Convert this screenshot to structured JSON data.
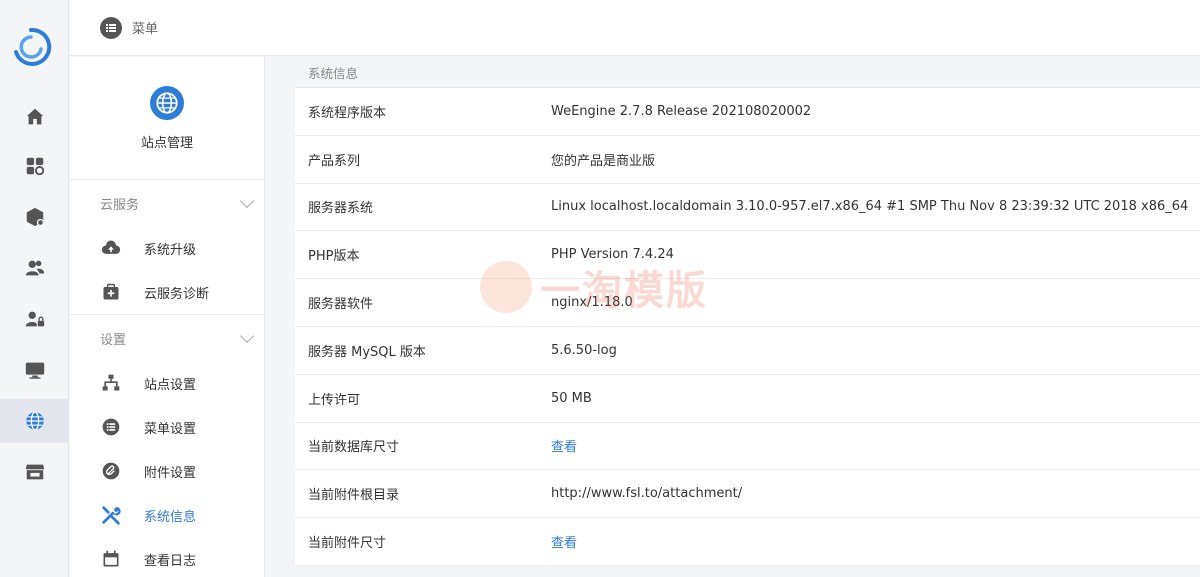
{
  "header": {
    "title": "菜单"
  },
  "rail": {
    "items": [
      {
        "icon": "home-icon"
      },
      {
        "icon": "apps-icon"
      },
      {
        "icon": "module-icon"
      },
      {
        "icon": "users-icon"
      },
      {
        "icon": "user-lock-icon"
      },
      {
        "icon": "monitor-icon"
      },
      {
        "icon": "globe-icon"
      },
      {
        "icon": "store-icon"
      }
    ]
  },
  "sidebar": {
    "site_label": "站点管理",
    "groups": [
      {
        "label": "云服务",
        "items": [
          {
            "label": "系统升级",
            "icon": "cloud-upload-icon"
          },
          {
            "label": "云服务诊断",
            "icon": "medkit-icon"
          }
        ]
      },
      {
        "label": "设置",
        "items": [
          {
            "label": "站点设置",
            "icon": "sitemap-icon"
          },
          {
            "label": "菜单设置",
            "icon": "list-icon"
          },
          {
            "label": "附件设置",
            "icon": "paperclip-icon"
          },
          {
            "label": "系统信息",
            "icon": "tools-icon"
          },
          {
            "label": "查看日志",
            "icon": "calendar-icon"
          }
        ]
      }
    ]
  },
  "system_info": {
    "heading": "系统信息",
    "rows": [
      {
        "key": "系统程序版本",
        "value": "WeEngine 2.7.8 Release 202108020002"
      },
      {
        "key": "产品系列",
        "value": "您的产品是商业版"
      },
      {
        "key": "服务器系统",
        "value": "Linux localhost.localdomain 3.10.0-957.el7.x86_64 #1 SMP Thu Nov 8 23:39:32 UTC 2018 x86_64"
      },
      {
        "key": "PHP版本",
        "value": "PHP Version 7.4.24"
      },
      {
        "key": "服务器软件",
        "value": "nginx/1.18.0"
      },
      {
        "key": "服务器 MySQL 版本",
        "value": "5.6.50-log"
      },
      {
        "key": "上传许可",
        "value": "50 MB"
      },
      {
        "key": "当前数据库尺寸",
        "value": "查看"
      },
      {
        "key": "当前附件根目录",
        "value": "http://www.fsl.to/attachment/"
      },
      {
        "key": "当前附件尺寸",
        "value": "查看"
      }
    ]
  },
  "watermark": {
    "text": "一淘模版"
  },
  "colors": {
    "accent": "#2f7bd8",
    "rail_bg": "#f4f5f7",
    "text": "#333333"
  }
}
